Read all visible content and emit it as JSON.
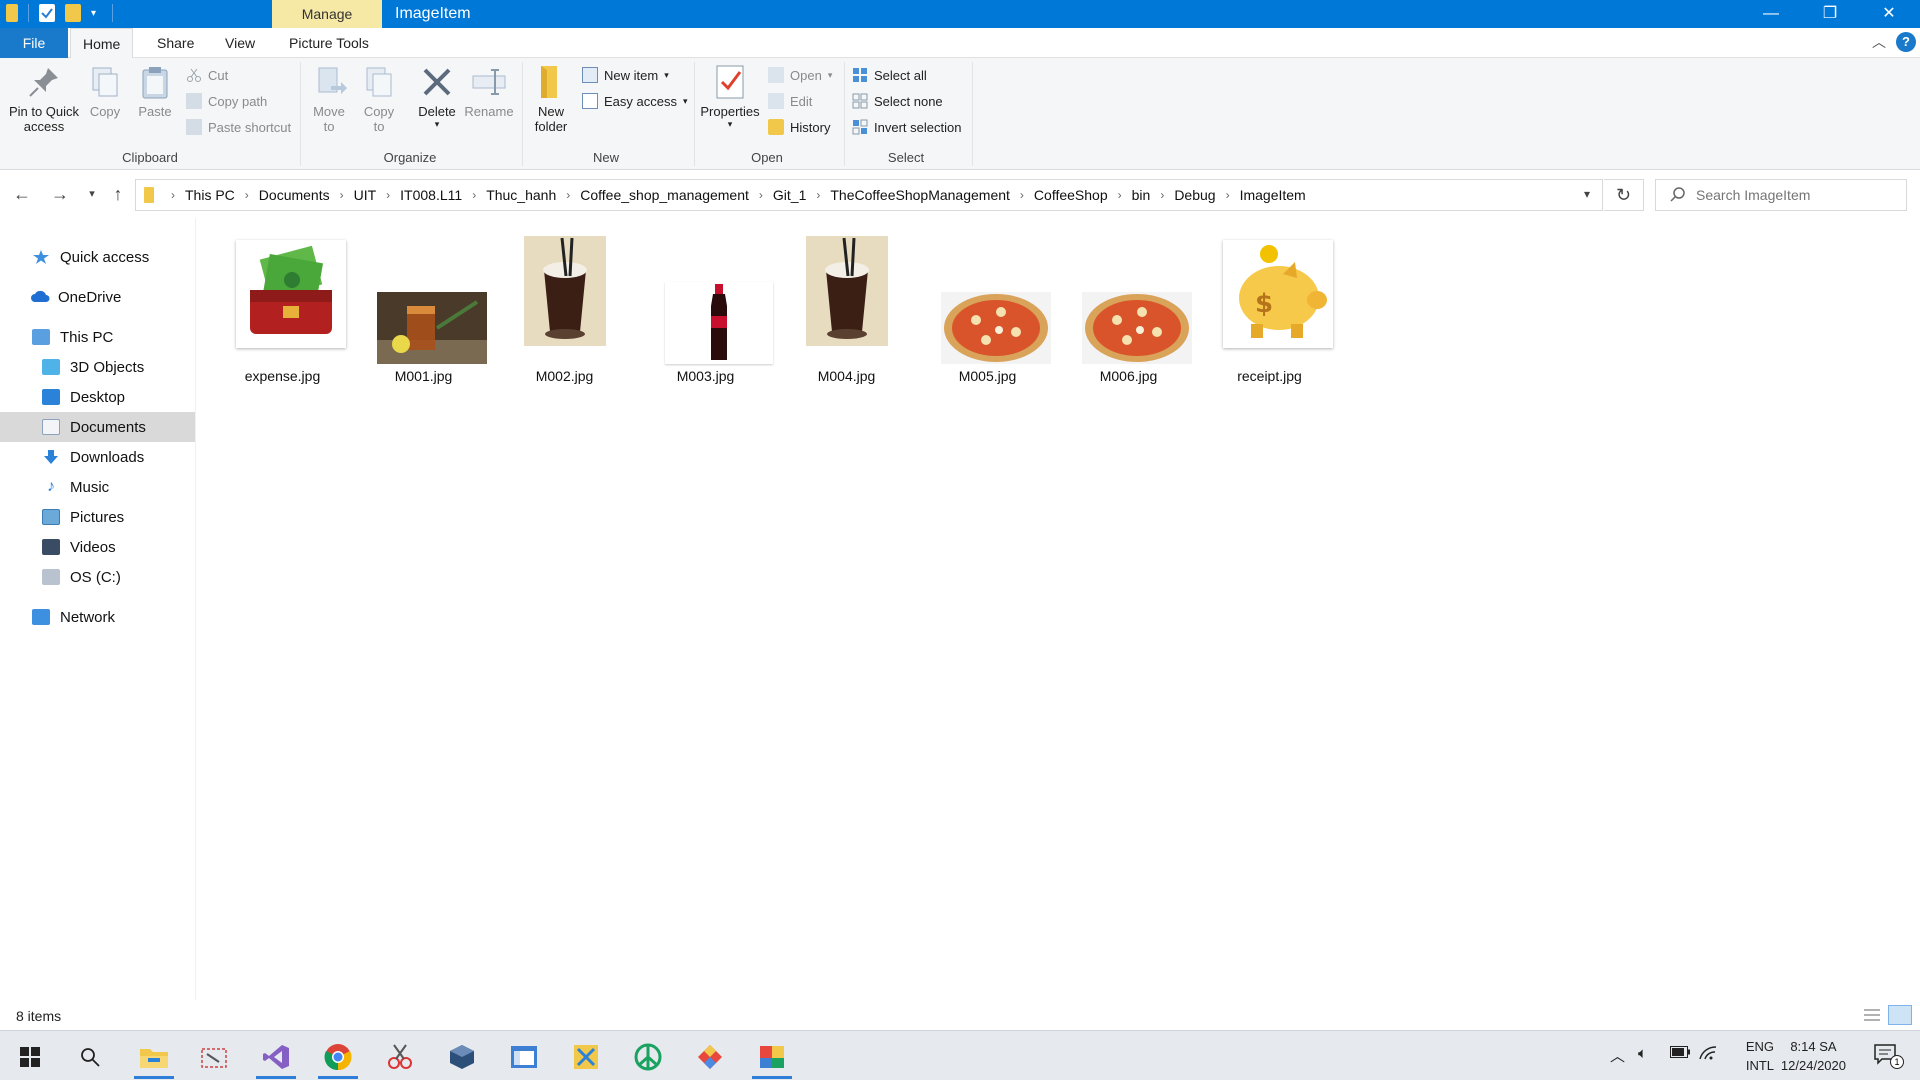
{
  "window": {
    "title": "ImageItem",
    "contextual_tab": "Manage",
    "controls": {
      "minimize": "—",
      "restore": "❐",
      "close": "✕"
    }
  },
  "ribbon_tabs": [
    "File",
    "Home",
    "Share",
    "View",
    "Picture Tools"
  ],
  "ribbon": {
    "clipboard": {
      "label": "Clipboard",
      "pin_line1": "Pin to Quick",
      "pin_line2": "access",
      "copy": "Copy",
      "paste": "Paste",
      "cut": "Cut",
      "copy_path": "Copy path",
      "paste_shortcut": "Paste shortcut"
    },
    "organize": {
      "label": "Organize",
      "move_to_1": "Move",
      "move_to_2": "to",
      "copy_to_1": "Copy",
      "copy_to_2": "to",
      "delete": "Delete",
      "rename": "Rename"
    },
    "new": {
      "label": "New",
      "new_item": "New item",
      "easy_access": "Easy access",
      "new_folder_1": "New",
      "new_folder_2": "folder"
    },
    "open": {
      "label": "Open",
      "properties": "Properties",
      "open": "Open",
      "edit": "Edit",
      "history": "History"
    },
    "select": {
      "label": "Select",
      "select_all": "Select all",
      "select_none": "Select none",
      "invert_selection": "Invert selection"
    }
  },
  "breadcrumbs": [
    "This PC",
    "Documents",
    "UIT",
    "IT008.L11",
    "Thuc_hanh",
    "Coffee_shop_management",
    "Git_1",
    "TheCoffeeShopManagement",
    "CoffeeShop",
    "bin",
    "Debug",
    "ImageItem"
  ],
  "search": {
    "placeholder": "Search ImageItem"
  },
  "nav_pane": {
    "quick_access": "Quick access",
    "onedrive": "OneDrive",
    "this_pc": "This PC",
    "objects3d": "3D Objects",
    "desktop": "Desktop",
    "documents": "Documents",
    "downloads": "Downloads",
    "music": "Music",
    "pictures": "Pictures",
    "videos": "Videos",
    "os_c": "OS (C:)",
    "network": "Network"
  },
  "files": [
    "expense.jpg",
    "M001.jpg",
    "M002.jpg",
    "M003.jpg",
    "M004.jpg",
    "M005.jpg",
    "M006.jpg",
    "receipt.jpg"
  ],
  "status": {
    "item_count": "8 items"
  },
  "taskbar": {
    "lang_1": "ENG",
    "lang_2": "INTL",
    "time": "8:14 SA",
    "date": "12/24/2020",
    "notifications": "1"
  },
  "colors": {
    "accent": "#0078d7",
    "manage_tab": "#f6e8a5",
    "selection": "#d9d9d9"
  }
}
